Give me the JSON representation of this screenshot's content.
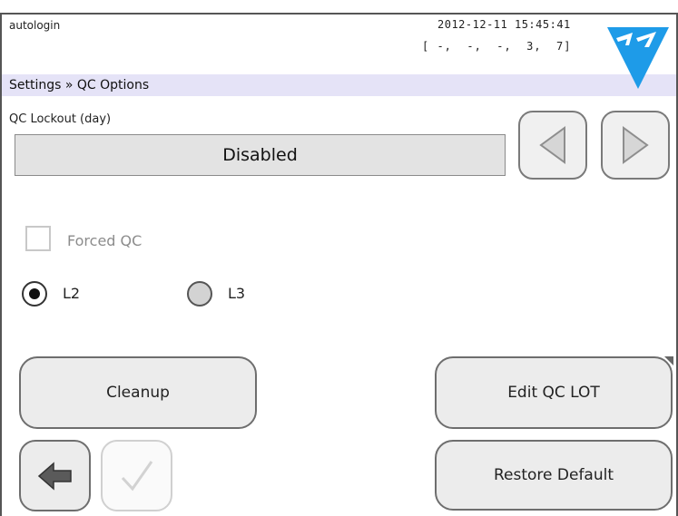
{
  "header": {
    "user": "autologin",
    "datetime": "2012-12-11 15:45:41",
    "status_codes": "[ -,  -,  -,  3,  7]",
    "logo_icon": "77-elektronika-logo-icon",
    "logo_color": "#1e9be8"
  },
  "breadcrumb": {
    "text": "Settings » QC Options",
    "background": "#e5e3f7"
  },
  "qc_lockout": {
    "label": "QC Lockout (day)",
    "value": "Disabled",
    "prev_icon": "triangle-left-icon",
    "next_icon": "triangle-right-icon"
  },
  "forced_qc": {
    "label": "Forced QC",
    "checked": false,
    "enabled": false
  },
  "level_options": {
    "selected": "L2",
    "options": [
      {
        "label": "L2"
      },
      {
        "label": "L3"
      }
    ]
  },
  "buttons": {
    "cleanup": "Cleanup",
    "edit_qc_lot": "Edit QC LOT",
    "restore_default": "Restore Default",
    "back_icon": "arrow-left-icon",
    "confirm_icon": "checkmark-icon"
  }
}
